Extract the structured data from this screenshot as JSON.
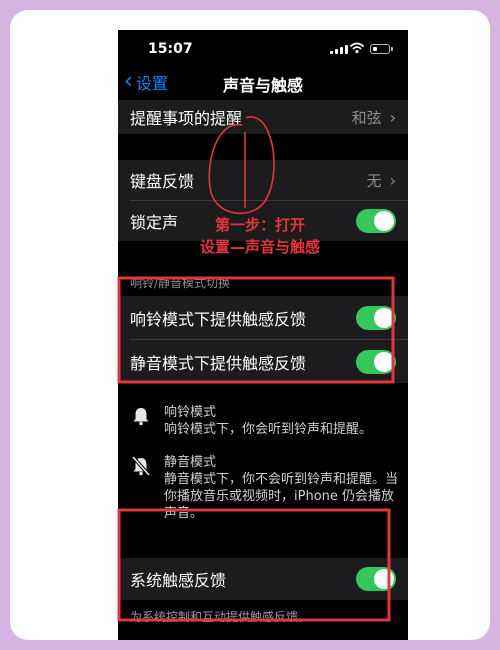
{
  "status": {
    "time": "15:07"
  },
  "nav": {
    "back_label": "设置",
    "title": "声音与触感"
  },
  "rows_top": [
    {
      "label": "提醒事项的提醒",
      "value": "和弦"
    }
  ],
  "rows_feedback": [
    {
      "label": "键盘反馈",
      "value": "无"
    },
    {
      "label": "锁定声"
    }
  ],
  "section_ring": {
    "header": "响铃/静音模式切换"
  },
  "rows_haptic": [
    {
      "label": "响铃模式下提供触感反馈"
    },
    {
      "label": "静音模式下提供触感反馈"
    }
  ],
  "info": [
    {
      "title": "响铃模式",
      "desc": "响铃模式下，你会听到铃声和提醒。"
    },
    {
      "title": "静音模式",
      "desc": "静音模式下，你不会听到铃声和提醒。当你播放音乐或视频时，iPhone 仍会播放声音。"
    }
  ],
  "system_haptic": {
    "label": "系统触感反馈",
    "footer": "为系统控制和互动提供触感反馈。"
  },
  "annotation": {
    "line1": "第一步：打开",
    "line2": "设置—声音与触感"
  },
  "colors": {
    "accent": "#0a84ff",
    "toggle_on": "#34c759",
    "annotation": "#e8353b",
    "frame_border": "#d6b4e2"
  }
}
